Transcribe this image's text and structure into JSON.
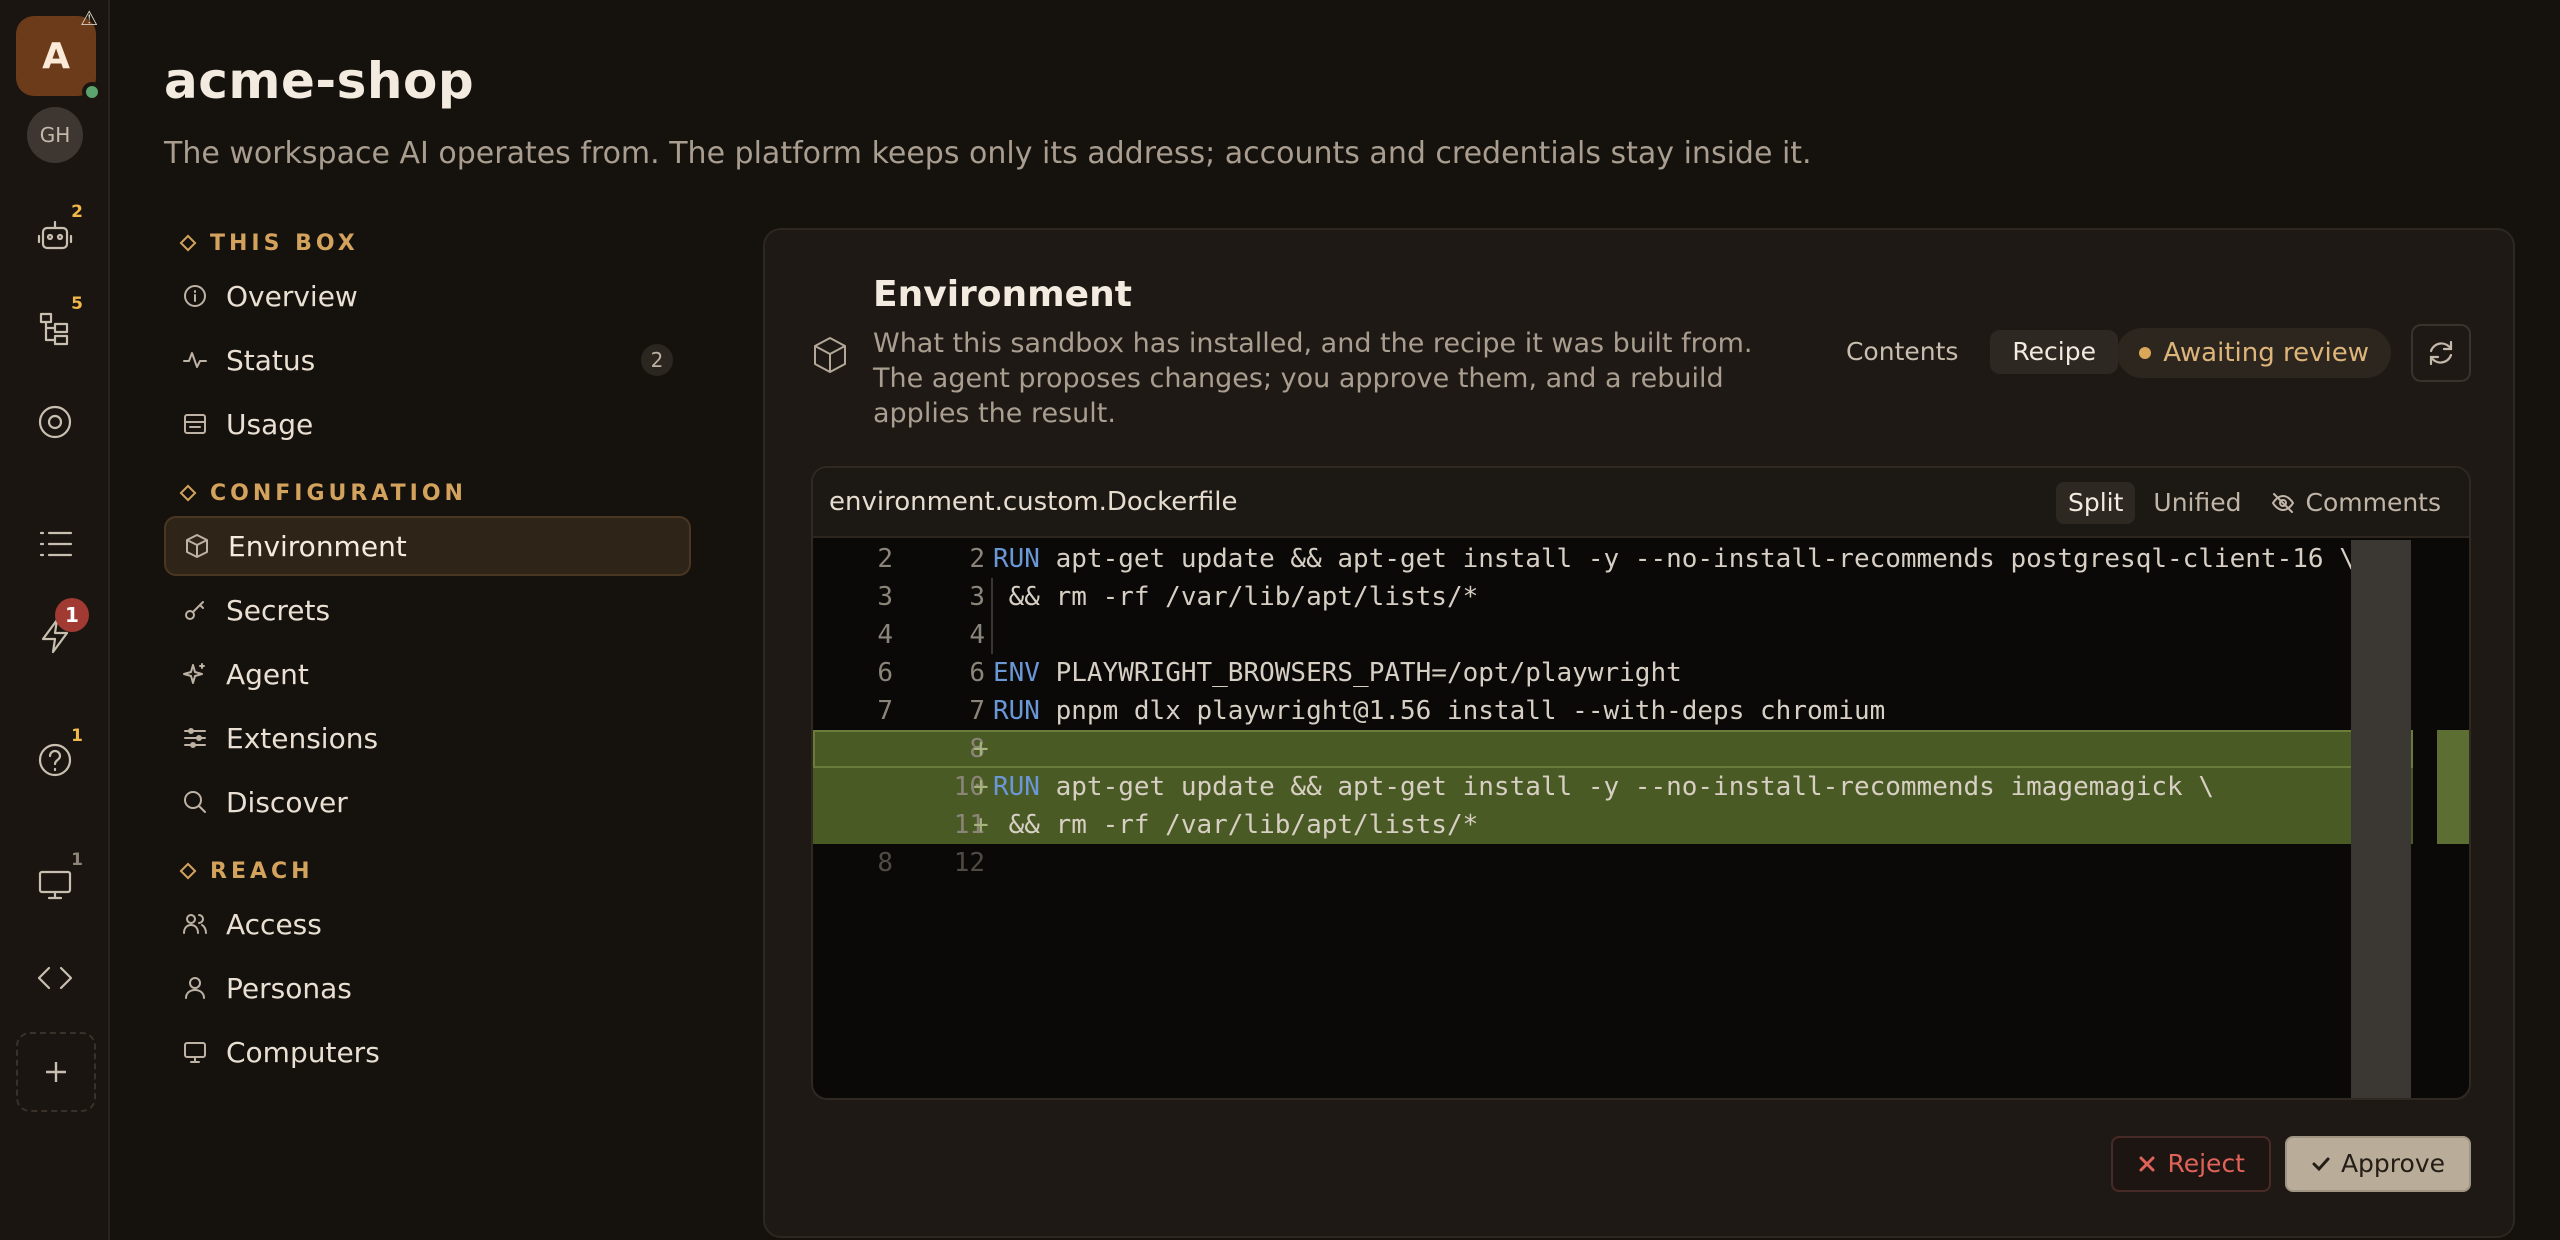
{
  "rail": {
    "workspace_avatar": "A",
    "warning_glyph": "⚠",
    "account_avatar": "GH",
    "items": [
      {
        "icon": "robot-icon",
        "badge": "2"
      },
      {
        "icon": "tree-icon",
        "badge": "5"
      },
      {
        "icon": "eye-icon",
        "badge": ""
      },
      {
        "icon": "list-icon",
        "badge": ""
      },
      {
        "icon": "bolt-icon",
        "badge": "1"
      },
      {
        "icon": "help-icon",
        "badge": "1"
      },
      {
        "icon": "monitor-icon",
        "badge": "1"
      },
      {
        "icon": "code-icon",
        "badge": ""
      }
    ],
    "add_icon": "plus-icon"
  },
  "header": {
    "title": "acme-shop",
    "subtitle": "The workspace AI operates from. The platform keeps only its address; accounts and credentials stay inside it."
  },
  "nav": {
    "sections": [
      {
        "label": "THIS BOX",
        "items": [
          {
            "label": "Overview",
            "icon": "info-icon"
          },
          {
            "label": "Status",
            "icon": "pulse-icon",
            "count": "2"
          },
          {
            "label": "Usage",
            "icon": "usage-icon"
          }
        ]
      },
      {
        "label": "CONFIGURATION",
        "items": [
          {
            "label": "Environment",
            "icon": "cube-icon",
            "active": true
          },
          {
            "label": "Secrets",
            "icon": "key-icon"
          },
          {
            "label": "Agent",
            "icon": "sparkle-icon"
          },
          {
            "label": "Extensions",
            "icon": "sliders-icon"
          },
          {
            "label": "Discover",
            "icon": "search-icon"
          }
        ]
      },
      {
        "label": "REACH",
        "items": [
          {
            "label": "Access",
            "icon": "users-icon"
          },
          {
            "label": "Personas",
            "icon": "user-icon"
          },
          {
            "label": "Computers",
            "icon": "monitor-icon"
          }
        ]
      }
    ]
  },
  "panel": {
    "title": "Environment",
    "description": "What this sandbox has installed, and the recipe it was built from. The agent proposes changes; you approve them, and a rebuild applies the result.",
    "tabs": [
      "Contents",
      "Recipe"
    ],
    "active_tab": "Recipe",
    "status": "Awaiting review",
    "status_color": "#d9a65a",
    "diff": {
      "filename": "environment.custom.Dockerfile",
      "modes": [
        "Split",
        "Unified"
      ],
      "active_mode": "Split",
      "comments_label": "Comments",
      "lines": [
        {
          "old": "2",
          "new": "2",
          "mark": "",
          "type": "ctx",
          "kw": "RUN",
          "code": " apt-get update && apt-get install -y --no-install-recommends postgresql-client-16 \\"
        },
        {
          "old": "3",
          "new": "3",
          "mark": "",
          "type": "ctx",
          "kw": "",
          "code": " && rm -rf /var/lib/apt/lists/*"
        },
        {
          "old": "4",
          "new": "4",
          "mark": "",
          "type": "ctx",
          "kw": "",
          "code": ""
        },
        {
          "old": "6",
          "new": "6",
          "mark": "",
          "type": "ctx",
          "kw": "ENV",
          "code": " PLAYWRIGHT_BROWSERS_PATH=/opt/playwright"
        },
        {
          "old": "7",
          "new": "7",
          "mark": "",
          "type": "ctx",
          "kw": "RUN",
          "code": " pnpm dlx playwright@1.56 install --with-deps chromium"
        },
        {
          "old": "",
          "new": "8",
          "mark": "+",
          "type": "add-empty",
          "kw": "",
          "code": ""
        },
        {
          "old": "",
          "new": "10",
          "mark": "+",
          "type": "add",
          "kw": "RUN",
          "code": " apt-get update && apt-get install -y --no-install-recommends imagemagick \\"
        },
        {
          "old": "",
          "new": "11",
          "mark": "+",
          "type": "add",
          "kw": "",
          "code": " && rm -rf /var/lib/apt/lists/*"
        },
        {
          "old": "8",
          "new": "12",
          "mark": "",
          "type": "dim",
          "kw": "",
          "code": ""
        }
      ]
    },
    "actions": {
      "reject": "Reject",
      "approve": "Approve"
    }
  }
}
